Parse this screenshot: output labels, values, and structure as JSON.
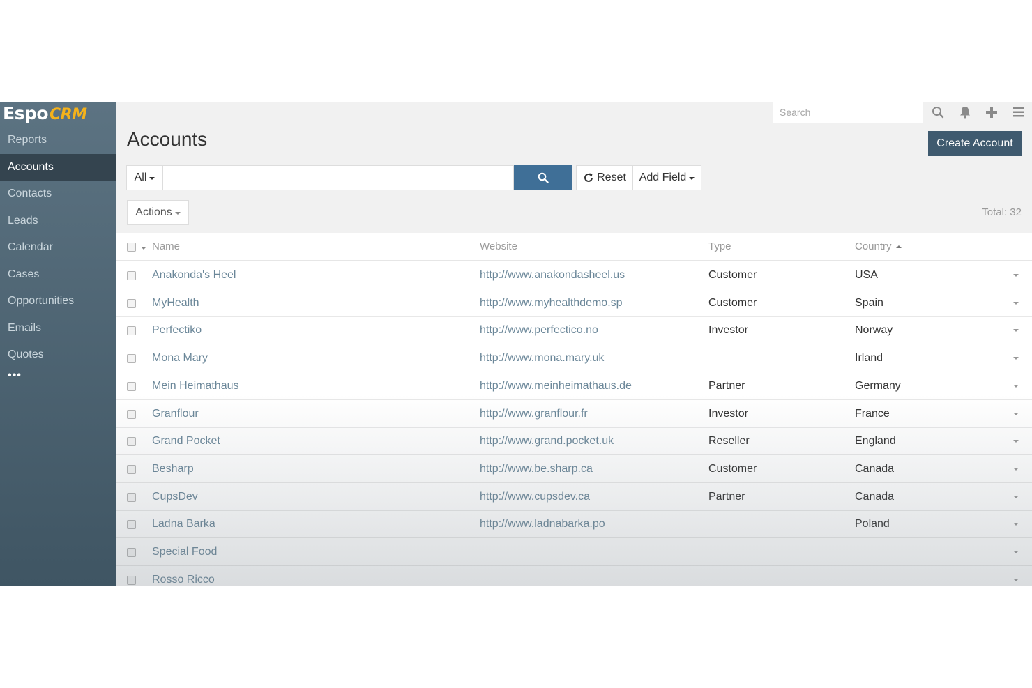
{
  "app": {
    "logo_main": "Espo",
    "logo_accent": "CRM"
  },
  "sidebar": {
    "items": [
      {
        "label": "Reports"
      },
      {
        "label": "Accounts",
        "active": true
      },
      {
        "label": "Contacts"
      },
      {
        "label": "Leads"
      },
      {
        "label": "Calendar"
      },
      {
        "label": "Cases"
      },
      {
        "label": "Opportunities"
      },
      {
        "label": "Emails"
      },
      {
        "label": "Quotes"
      }
    ],
    "more": "•••"
  },
  "topbar": {
    "search_placeholder": "Search"
  },
  "page": {
    "title": "Accounts",
    "create_button": "Create Account",
    "filter_all": "All",
    "reset": "Reset",
    "add_field": "Add Field",
    "actions": "Actions",
    "total": "Total: 32"
  },
  "table": {
    "columns": {
      "name": "Name",
      "website": "Website",
      "type": "Type",
      "country": "Country"
    },
    "rows": [
      {
        "name": "Anakonda's Heel",
        "website": "http://www.anakondasheel.us",
        "type": "Customer",
        "country": "USA"
      },
      {
        "name": "MyHealth",
        "website": "http://www.myhealthdemo.sp",
        "type": "Customer",
        "country": "Spain"
      },
      {
        "name": "Perfectiko",
        "website": "http://www.perfectico.no",
        "type": "Investor",
        "country": "Norway"
      },
      {
        "name": "Mona Mary",
        "website": "http://www.mona.mary.uk",
        "type": "",
        "country": "Irland"
      },
      {
        "name": "Mein Heimathaus",
        "website": "http://www.meinheimathaus.de",
        "type": "Partner",
        "country": "Germany"
      },
      {
        "name": "Granflour",
        "website": "http://www.granflour.fr",
        "type": "Investor",
        "country": "France"
      },
      {
        "name": "Grand Pocket",
        "website": "http://www.grand.pocket.uk",
        "type": "Reseller",
        "country": "England"
      },
      {
        "name": "Besharp",
        "website": "http://www.be.sharp.ca",
        "type": "Customer",
        "country": "Canada"
      },
      {
        "name": "CupsDev",
        "website": "http://www.cupsdev.ca",
        "type": "Partner",
        "country": "Canada"
      },
      {
        "name": "Ladna Barka",
        "website": "http://www.ladnabarka.po",
        "type": "",
        "country": "Poland"
      },
      {
        "name": "Special Food",
        "website": "",
        "type": "",
        "country": ""
      },
      {
        "name": "Rosso Ricco",
        "website": "",
        "type": "",
        "country": ""
      }
    ]
  },
  "colors": {
    "sidebar": "#4d6372",
    "primary_button": "#3f5a6f",
    "search_button": "#3f6f97",
    "link": "#6b8799",
    "logo_accent": "#f5b21b"
  }
}
